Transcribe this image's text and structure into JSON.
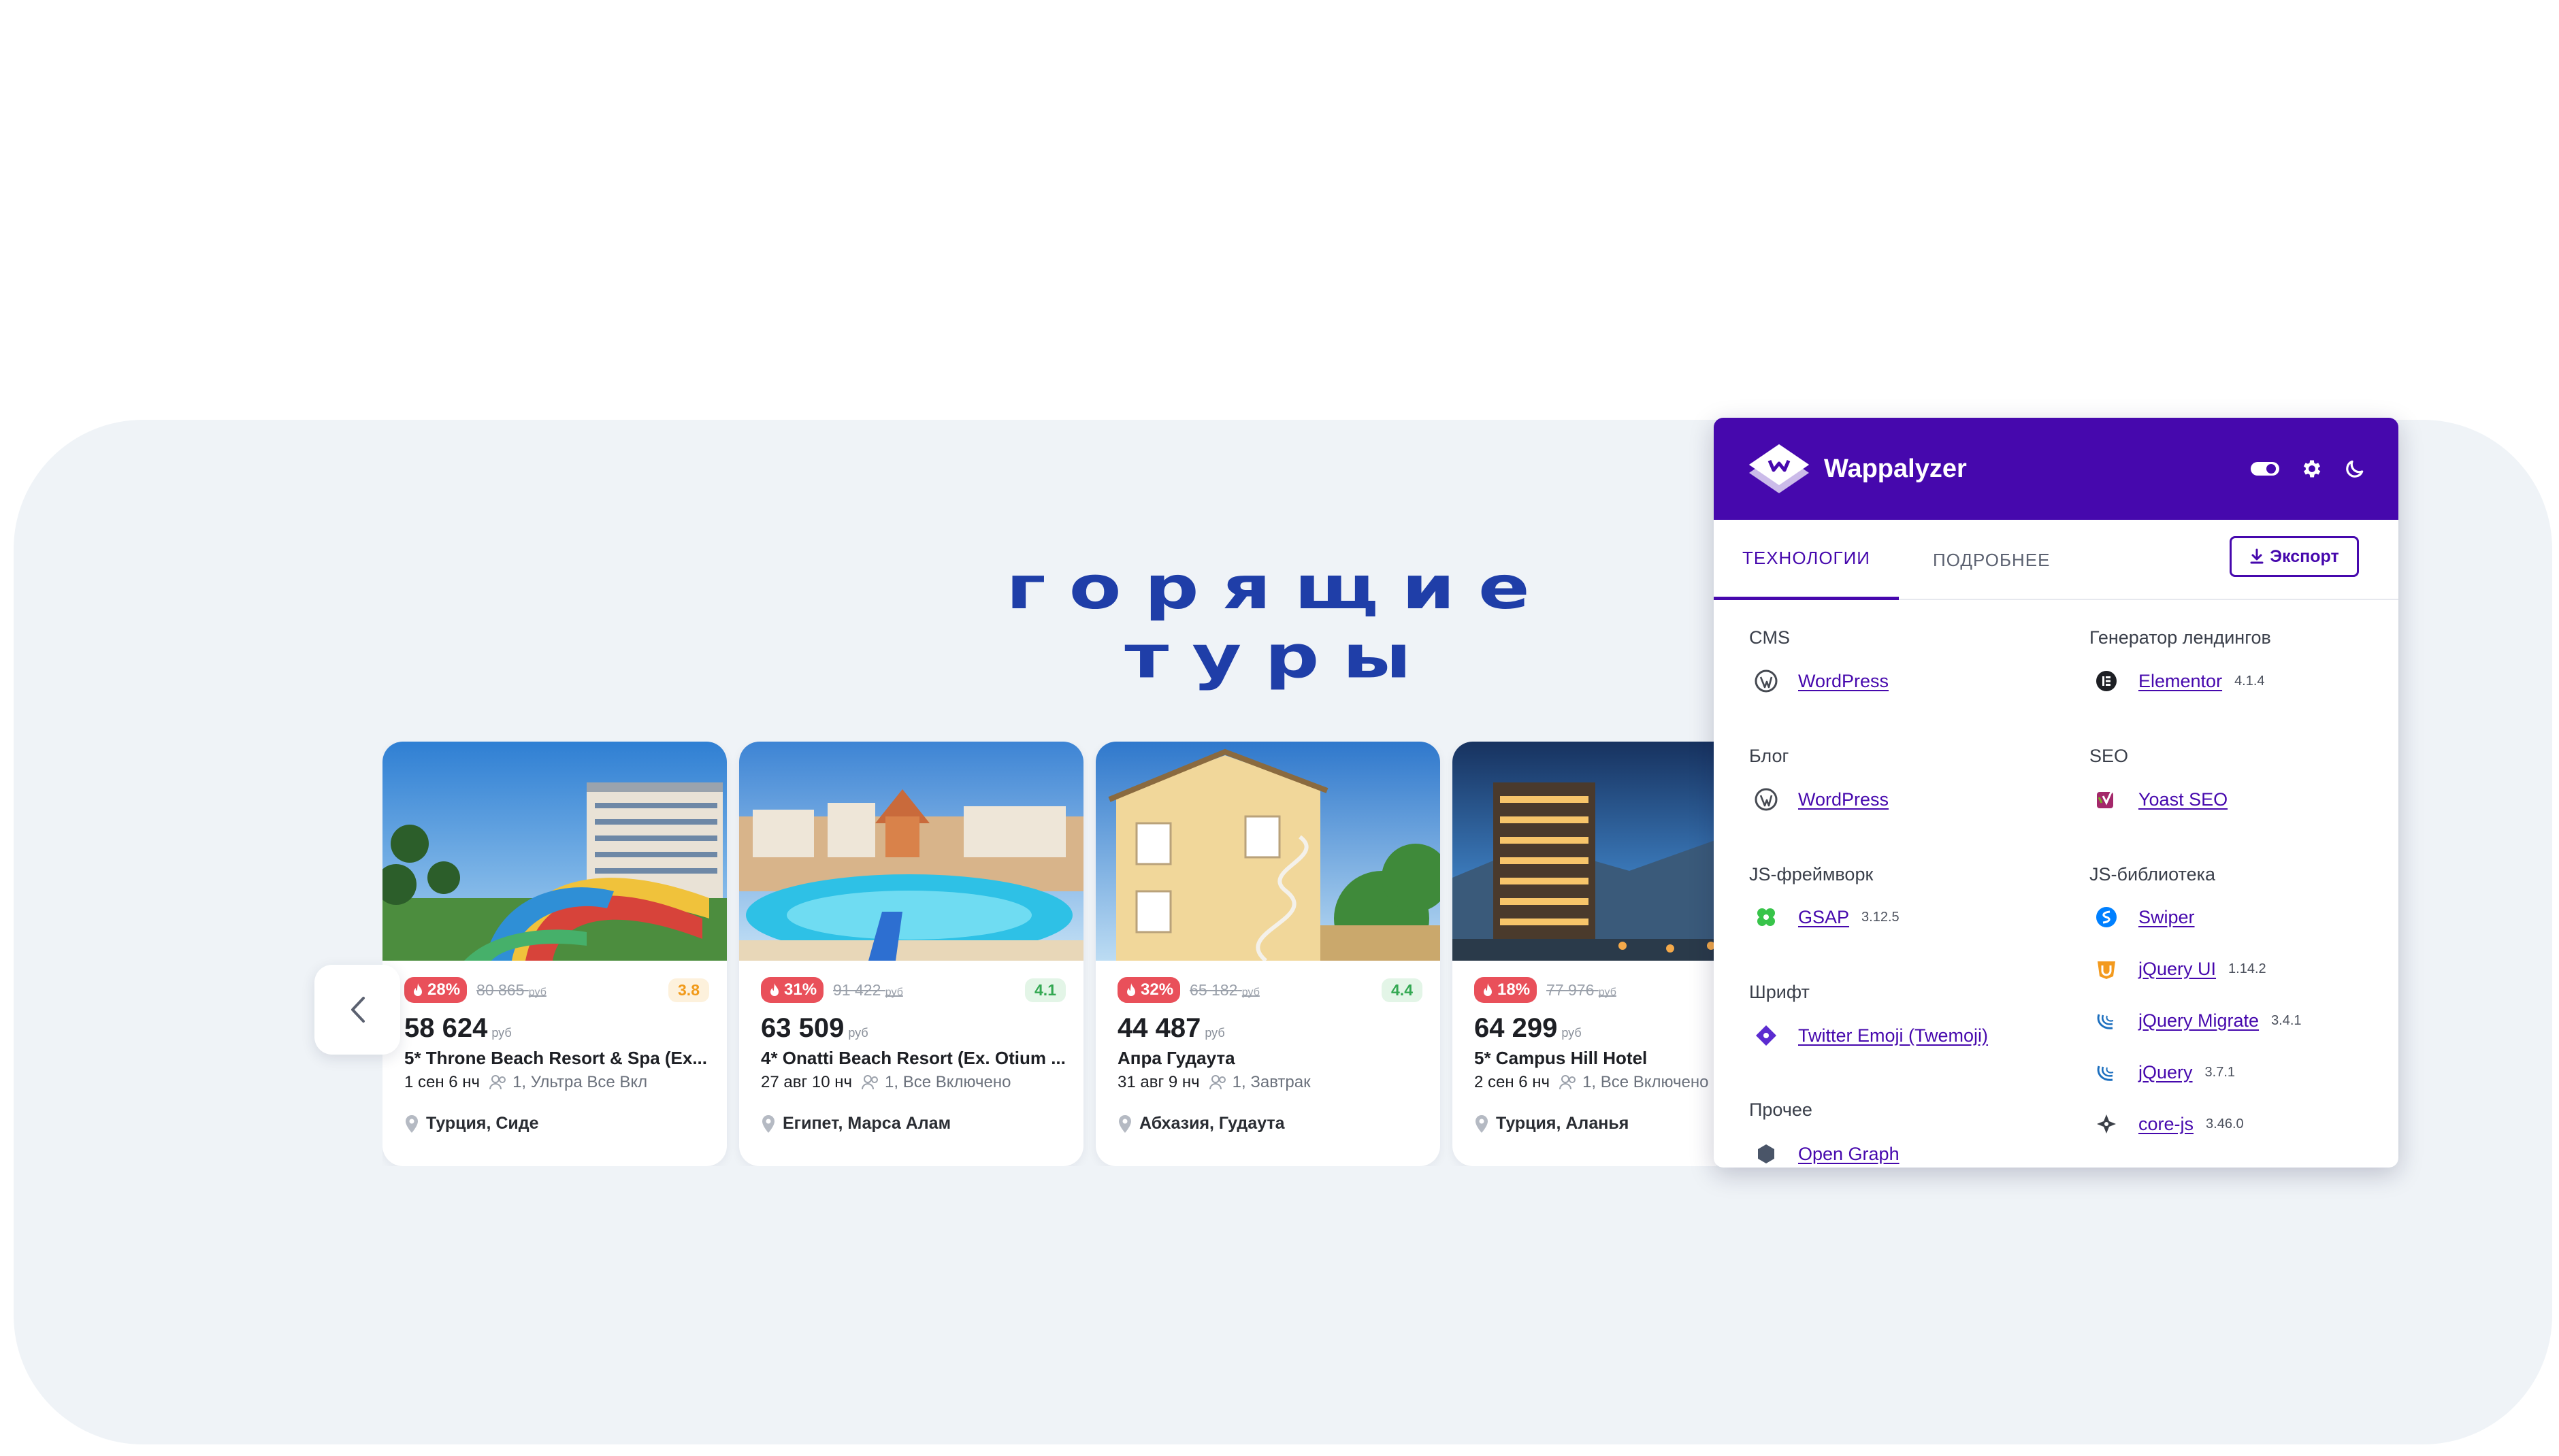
{
  "section": {
    "title": "горящие туры"
  },
  "cards": [
    {
      "discount": "28%",
      "old_price": "80 865",
      "currency": "руб",
      "rating": "3.8",
      "rating_color": "#f19a1a",
      "rating_bg": "#fdf1dc",
      "price": "58 624",
      "hotel": "5* Throne Beach Resort & Spa (Ex...",
      "date": "1 сен 6 нч",
      "guests": "1,",
      "meal": "Ультра Все Вкл",
      "location": "Турция, Сиде"
    },
    {
      "discount": "31%",
      "old_price": "91 422",
      "currency": "руб",
      "rating": "4.1",
      "rating_color": "#33a852",
      "rating_bg": "#e3f5e7",
      "price": "63 509",
      "hotel": "4* Onatti Beach Resort (Ex. Otium ...",
      "date": "27 авг 10 нч",
      "guests": "1,",
      "meal": "Все Включено",
      "location": "Египет, Марса Алам"
    },
    {
      "discount": "32%",
      "old_price": "65 182",
      "currency": "руб",
      "rating": "4.4",
      "rating_color": "#33a852",
      "rating_bg": "#e3f5e7",
      "price": "44 487",
      "hotel": "Апра Гудаута",
      "date": "31 авг 9 нч",
      "guests": "1,",
      "meal": "Завтрак",
      "location": "Абхазия, Гудаута"
    },
    {
      "discount": "18%",
      "old_price": "77 976",
      "currency": "руб",
      "rating": "",
      "rating_color": "#33a852",
      "rating_bg": "#e3f5e7",
      "price": "64 299",
      "hotel": "5* Campus Hill Hotel",
      "date": "2 сен 6 нч",
      "guests": "1,",
      "meal": "Все Включено",
      "location": "Турция, Аланья"
    }
  ],
  "wappalyzer": {
    "name": "Wappalyzer",
    "brand_color": "#4608ad",
    "tabs": {
      "tech": "ТЕХНОЛОГИИ",
      "more": "ПОДРОБНЕЕ"
    },
    "export_label": "Экспорт",
    "categories": {
      "cms": "CMS",
      "landing": "Генератор лендингов",
      "blog": "Блог",
      "seo": "SEO",
      "jsfw": "JS-фреймворк",
      "jslib": "JS-библиотека",
      "font": "Шрифт",
      "misc": "Прочее"
    },
    "techs": {
      "wordpress_cms": {
        "name": "WordPress",
        "icon": "wordpress-icon"
      },
      "elementor": {
        "name": "Elementor",
        "version": "4.1.4",
        "icon": "elementor-icon"
      },
      "wordpress_blog": {
        "name": "WordPress",
        "icon": "wordpress-icon"
      },
      "yoast": {
        "name": "Yoast SEO",
        "icon": "yoast-icon"
      },
      "gsap": {
        "name": "GSAP",
        "version": "3.12.5",
        "icon": "gsap-icon"
      },
      "swiper": {
        "name": "Swiper",
        "icon": "swiper-icon"
      },
      "jqueryui": {
        "name": "jQuery UI",
        "version": "1.14.2",
        "icon": "jquery-ui-icon"
      },
      "jquerymigrate": {
        "name": "jQuery Migrate",
        "version": "3.4.1",
        "icon": "jquery-icon"
      },
      "jquery": {
        "name": "jQuery",
        "version": "3.7.1",
        "icon": "jquery-icon"
      },
      "corejs": {
        "name": "core-js",
        "version": "3.46.0",
        "icon": "corejs-icon"
      },
      "twemoji": {
        "name": "Twitter Emoji (Twemoji)",
        "icon": "twemoji-icon"
      },
      "opengraph": {
        "name": "Open Graph",
        "icon": "opengraph-icon"
      }
    }
  }
}
